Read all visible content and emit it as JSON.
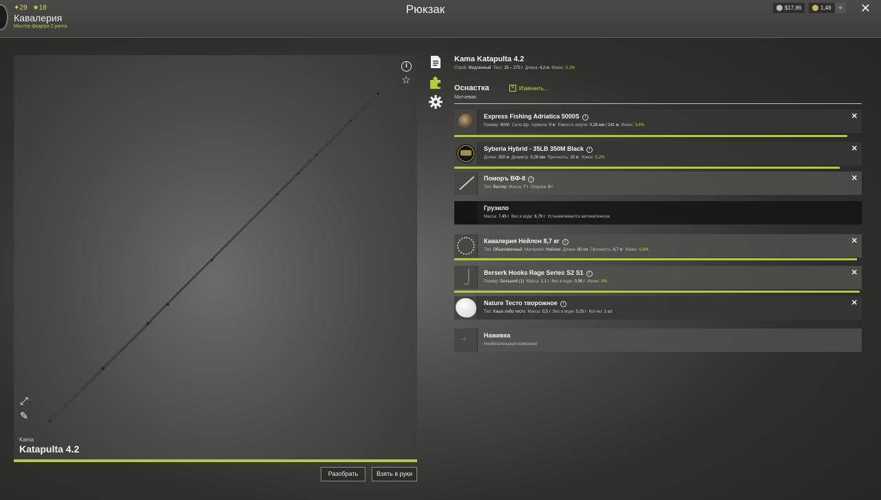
{
  "player": {
    "level": "29",
    "stars": "18",
    "name": "Кавалерия",
    "rank": "Мастер фидера 2 ранга"
  },
  "header": {
    "title": "Рюкзак",
    "silver": "$17,86",
    "gold": "1,48",
    "plus": "+",
    "close": "✕"
  },
  "preview": {
    "brand": "Kama",
    "name": "Katapulta 4.2",
    "disassemble_label": "Разобрать",
    "take_label": "Взять в руки"
  },
  "item": {
    "title": "Kama Katapulta 4.2",
    "specs": {
      "action_label": "Строй:",
      "action": "Медленный",
      "test_label": "Тест:",
      "test": "25 – 275 г",
      "length_label": "Длина:",
      "length": "4,2 м",
      "wear_label": "Износ:",
      "wear": "0,1%"
    }
  },
  "rig": {
    "title": "Оснастка",
    "type": "Матчевая",
    "change_label": "Изменить..."
  },
  "slots": [
    {
      "name": "Express Fishing Adriatica 5000S",
      "specs": [
        {
          "k": "Размер:",
          "v": "6000"
        },
        {
          "k": "Сила фр. тормоза:",
          "v": "9 кг"
        },
        {
          "k": "Емкость шпули:",
          "v": "0,28 мм / 241 м"
        },
        {
          "k": "Износ:",
          "v": "3,4%",
          "wear": true
        }
      ],
      "condition": 0.97
    },
    {
      "name": "Syberia Hybrid - 35LB 350M Black",
      "specs": [
        {
          "k": "Длина:",
          "v": "350 м"
        },
        {
          "k": "Диаметр:",
          "v": "0,28 мм"
        },
        {
          "k": "Прочность:",
          "v": "15 кг"
        },
        {
          "k": "Износ:",
          "v": "5,2%",
          "wear": true
        }
      ],
      "condition": 0.95
    },
    {
      "name": "Поморъ ВФ-8",
      "specs": [
        {
          "k": "Тип:",
          "v": "Ваглер"
        },
        {
          "k": "Масса:",
          "v": "7 г"
        },
        {
          "k": "Огрузка:",
          "v": "8 г"
        }
      ]
    },
    {
      "name": "Грузило",
      "specs": [
        {
          "k": "Масса:",
          "v": "7,45 г"
        },
        {
          "k": "Вес в воде:",
          "v": "6,79 г"
        },
        {
          "k": "",
          "v": "Устанавливается автоматически"
        }
      ]
    },
    {
      "name": "Кавалерия Нейлон 8,7 кг",
      "specs": [
        {
          "k": "Тип:",
          "v": "Обыкновенный"
        },
        {
          "k": "Материал:",
          "v": "Нейлон"
        },
        {
          "k": "Длина:",
          "v": "60 см"
        },
        {
          "k": "Прочность:",
          "v": "8,7 кг"
        },
        {
          "k": "Износ:",
          "v": "0,6%",
          "wear": true
        }
      ],
      "condition": 0.994
    },
    {
      "name": "Berserk Hooks Rage Series S2 S1",
      "specs": [
        {
          "k": "Размер:",
          "v": "Большой (1)"
        },
        {
          "k": "Масса:",
          "v": "1,1 г"
        },
        {
          "k": "Вес в воде:",
          "v": "0,96 г"
        },
        {
          "k": "Износ:",
          "v": "0%",
          "wear": true
        }
      ],
      "condition": 1.0
    },
    {
      "name": "Nature Тесто творожное",
      "specs": [
        {
          "k": "Тип:",
          "v": "Каша либо тесто"
        },
        {
          "k": "Масса:",
          "v": "0,5 г"
        },
        {
          "k": "Вес в воде:",
          "v": "0,25 г"
        },
        {
          "k": "Кол-во:",
          "v": "1 шт"
        }
      ]
    },
    {
      "name": "Наживка",
      "specs": [
        {
          "k": "",
          "v": "Необязательный компонент"
        }
      ]
    }
  ]
}
